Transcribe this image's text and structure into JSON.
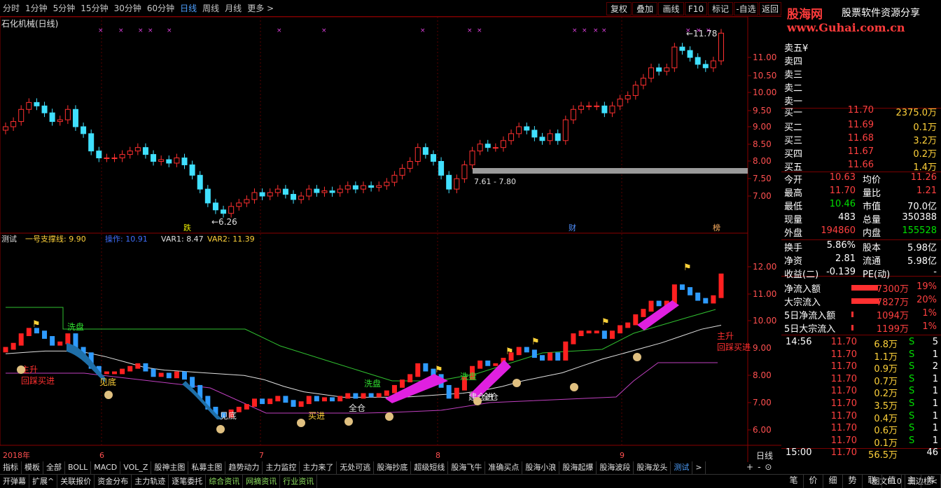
{
  "toolbar": {
    "periods": [
      "分时",
      "1分钟",
      "5分钟",
      "15分钟",
      "30分钟",
      "60分钟",
      "日线",
      "周线",
      "月线",
      "更多 >"
    ],
    "active_period": "日线",
    "right_buttons": [
      "复权",
      "叠加",
      "画线",
      "F10",
      "标记",
      "-自选",
      "返回"
    ]
  },
  "logo": {
    "line1": "股海网",
    "line1b": "股票软件资源分享",
    "line2": "www.Guhai.com.cn"
  },
  "main_chart": {
    "title": "石化机械(日线)",
    "high_label": "11.78",
    "low_label": "6.26",
    "range_label": "7.61 - 7.80",
    "markers": [
      "跌",
      "财",
      "榜"
    ],
    "y_ticks": [
      "11.00",
      "10.50",
      "10.00",
      "9.50",
      "9.00",
      "8.50",
      "8.00",
      "7.50",
      "7.00"
    ]
  },
  "indicator": {
    "name": "测试",
    "line1": "一号支撑线: 9.90",
    "line2": "操作: 10.91",
    "line3": "VAR1: 8.47",
    "line4": "VAR2: 11.39",
    "labels": [
      "洗盘",
      "洗盘",
      "洗盘",
      "主升",
      "回踩买进",
      "见底",
      "见底",
      "买进",
      "全仓",
      "全仓",
      "建仓进",
      "主升",
      "回踩买进"
    ],
    "y_ticks": [
      "12.00",
      "11.00",
      "10.00",
      "9.00",
      "8.00",
      "7.00",
      "6.00"
    ]
  },
  "x_axis": {
    "labels": [
      "2018年",
      "6",
      "7",
      "8",
      "9"
    ],
    "period_label": "日线"
  },
  "ask_bid": {
    "sells": [
      "卖五",
      "卖四",
      "卖三",
      "卖二",
      "卖一"
    ],
    "sell_extra": "¥",
    "buys": [
      {
        "label": "买一",
        "price": "11.70",
        "vol": "2375.0万"
      },
      {
        "label": "买二",
        "price": "11.69",
        "vol": "0.1万"
      },
      {
        "label": "买三",
        "price": "11.68",
        "vol": "3.2万"
      },
      {
        "label": "买四",
        "price": "11.67",
        "vol": "0.2万"
      },
      {
        "label": "买五",
        "price": "11.66",
        "vol": "1.4万"
      }
    ]
  },
  "quote": [
    {
      "l": "今开",
      "v": "10.63",
      "l2": "均价",
      "v2": "11.26"
    },
    {
      "l": "最高",
      "v": "11.70",
      "l2": "量比",
      "v2": "1.21"
    },
    {
      "l": "最低",
      "v": "10.46",
      "l2": "市值",
      "v2": "70.0亿"
    },
    {
      "l": "现量",
      "v": "483",
      "l2": "总量",
      "v2": "350388"
    },
    {
      "l": "外盘",
      "v": "194860",
      "l2": "内盘",
      "v2": "155528"
    }
  ],
  "finance": [
    {
      "l": "换手",
      "v": "5.86%",
      "l2": "股本",
      "v2": "5.98亿"
    },
    {
      "l": "净资",
      "v": "2.81",
      "l2": "流通",
      "v2": "5.98亿"
    },
    {
      "l": "收益(二)",
      "v": "-0.139",
      "l2": "PE(动)",
      "v2": "-"
    }
  ],
  "flows": [
    {
      "l": "净流入额",
      "v": "7300万",
      "p": "19%"
    },
    {
      "l": "大宗流入",
      "v": "7827万",
      "p": "20%"
    },
    {
      "l": "5日净流入额",
      "v": "1094万",
      "p": "1%"
    },
    {
      "l": "5日大宗流入",
      "v": "1199万",
      "p": "1%"
    }
  ],
  "ticks": [
    {
      "t": "14:56",
      "p": "11.70",
      "v": "6.8万",
      "s": "S",
      "n": "5"
    },
    {
      "t": "",
      "p": "11.70",
      "v": "1.1万",
      "s": "S",
      "n": "1"
    },
    {
      "t": "",
      "p": "11.70",
      "v": "0.9万",
      "s": "S",
      "n": "2"
    },
    {
      "t": "",
      "p": "11.70",
      "v": "0.7万",
      "s": "S",
      "n": "1"
    },
    {
      "t": "",
      "p": "11.70",
      "v": "0.2万",
      "s": "S",
      "n": "1"
    },
    {
      "t": "",
      "p": "11.70",
      "v": "3.5万",
      "s": "S",
      "n": "1"
    },
    {
      "t": "",
      "p": "11.70",
      "v": "0.4万",
      "s": "S",
      "n": "1"
    },
    {
      "t": "",
      "p": "11.70",
      "v": "0.6万",
      "s": "S",
      "n": "1"
    },
    {
      "t": "",
      "p": "11.70",
      "v": "0.1万",
      "s": "S",
      "n": "1"
    },
    {
      "t": "15:00",
      "p": "11.70",
      "v": "56.5万",
      "s": "",
      "n": "46"
    }
  ],
  "tabs": [
    "指标",
    "模板",
    "全部",
    "BOLL",
    "MACD",
    "VOL_Z",
    "股神主图",
    "私募主图",
    "趋势动力",
    "主力监控",
    "主力来了",
    "无处可逃",
    "股海抄底",
    "超级短线",
    "股海飞牛",
    "准确买点",
    "股海小浪",
    "股海起爆",
    "股海波段",
    "股海龙头",
    "测试",
    ">"
  ],
  "active_tab": "测试",
  "tabs2": [
    "开弹幕",
    "扩展^",
    "关联报价",
    "资金分布",
    "主力轨迹",
    "逐笔委托",
    "综合资讯",
    "网摘资讯",
    "行业资讯",
    "图文F10",
    "侧边栏<"
  ],
  "tabs2_controls": [
    "+",
    "-",
    "⊙"
  ],
  "bottom_tabs": [
    "笔",
    "价",
    "细",
    "势",
    "联",
    "值",
    "主",
    "筹"
  ]
}
